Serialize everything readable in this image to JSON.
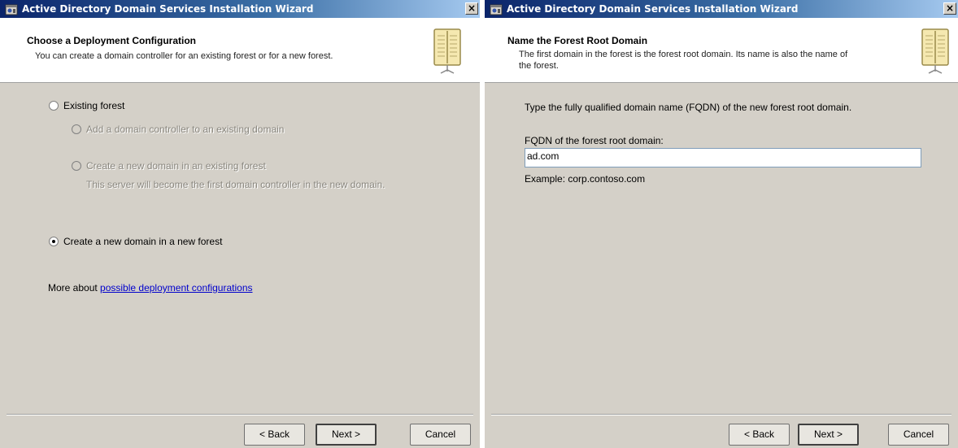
{
  "left_window": {
    "title": "Active Directory Domain Services Installation Wizard",
    "close_glyph": "×",
    "header_title": "Choose a Deployment Configuration",
    "header_desc": "You can create a domain controller for an existing forest or for a new forest.",
    "options": {
      "existing_forest": "Existing forest",
      "add_dc_existing_domain": "Add a domain controller to an existing domain",
      "new_domain_existing_forest": "Create a new domain in an existing forest",
      "new_domain_existing_forest_note": "This server will become the first domain controller in the new domain.",
      "new_domain_new_forest": "Create a new domain in a new forest"
    },
    "selected_option": "new_domain_new_forest",
    "more_about_prefix": "More about",
    "more_about_link": "possible deployment configurations",
    "buttons": {
      "back": "< Back",
      "next": "Next >",
      "cancel": "Cancel"
    }
  },
  "right_window": {
    "title": "Active Directory Domain Services Installation Wizard",
    "close_glyph": "×",
    "header_title": "Name the Forest Root Domain",
    "header_desc_line1": "The first domain in the forest is the forest root domain. Its name is also the name of",
    "header_desc_line2": "the forest.",
    "instruction": "Type the fully qualified domain name (FQDN) of the new forest root domain.",
    "fqdn_label": "FQDN of the forest root domain:",
    "fqdn_value": "ad.com",
    "example": "Example: corp.contoso.com",
    "buttons": {
      "back": "< Back",
      "next": "Next >",
      "cancel": "Cancel"
    }
  },
  "colors": {
    "titlebar_start": "#0a246a",
    "titlebar_end": "#a6caf0",
    "window_face": "#d4d0c8",
    "link": "#0000cc"
  },
  "icons": [
    "app-icon",
    "book-icon",
    "close-icon"
  ]
}
